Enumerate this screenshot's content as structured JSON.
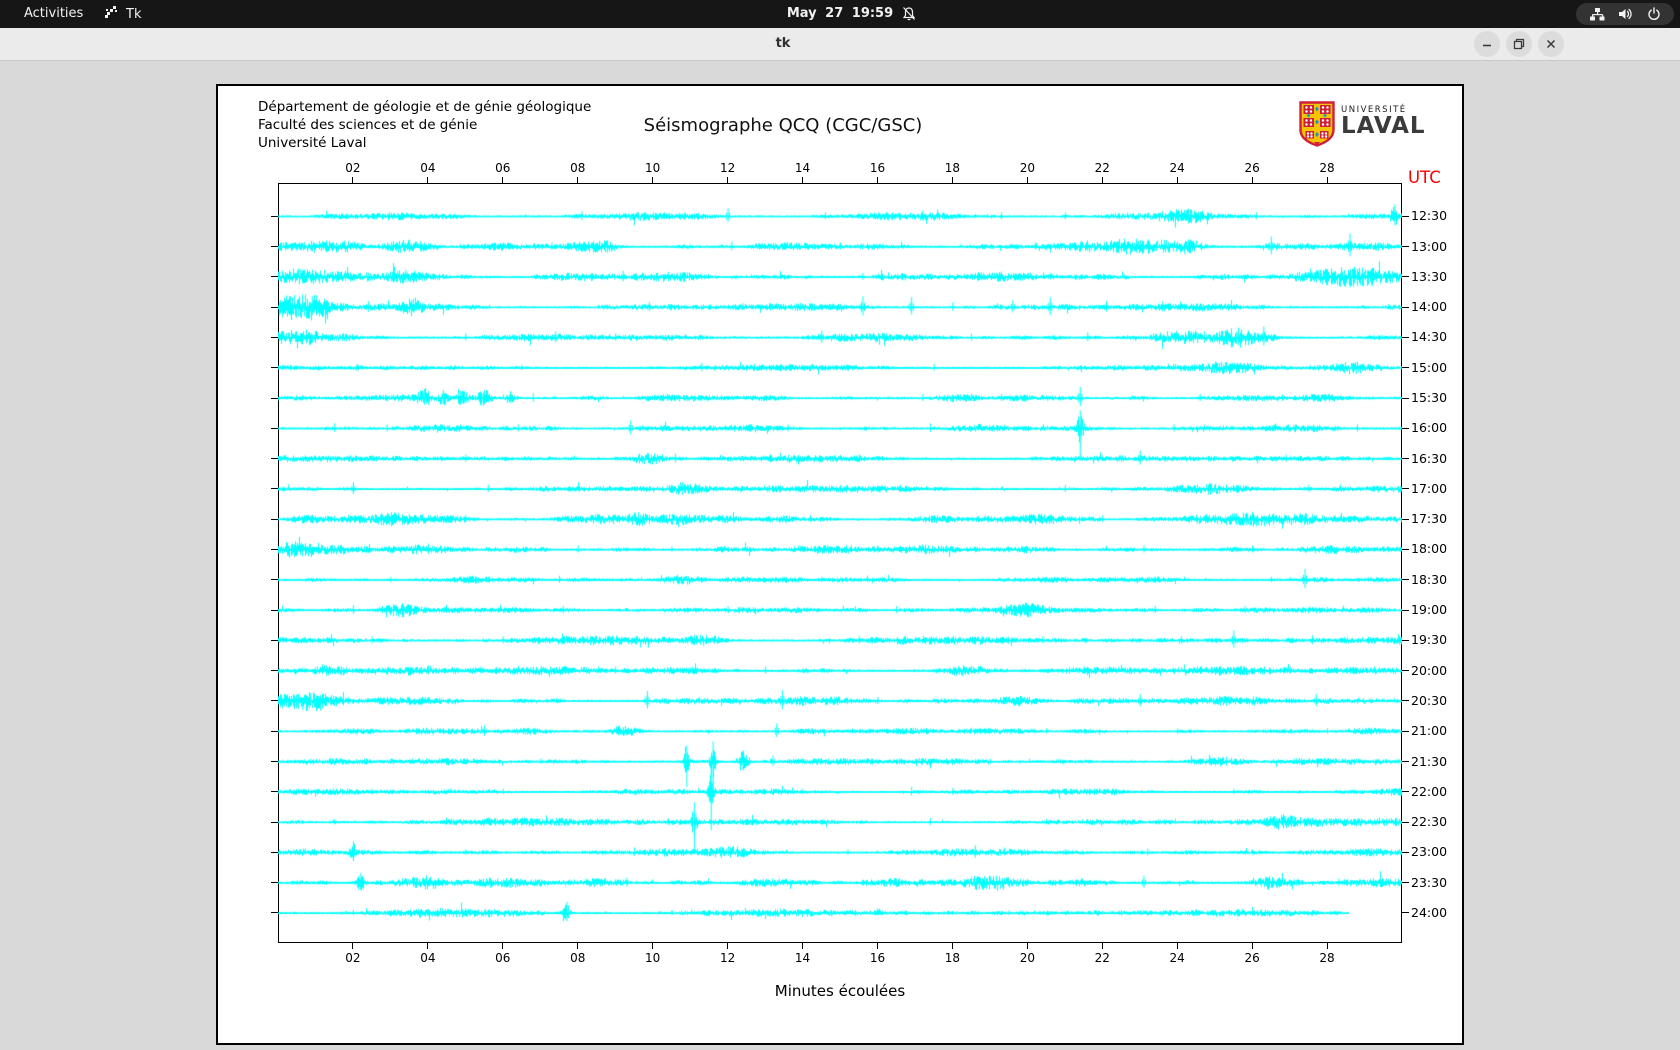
{
  "topbar": {
    "activities": "Activities",
    "app_name": "Tk",
    "clock": "May 27 19:59",
    "icons": [
      "tk-icon",
      "bell-muted-icon",
      "network-icon",
      "volume-icon",
      "power-icon"
    ]
  },
  "titlebar": {
    "title": "tk",
    "icons": [
      "minimize-icon",
      "restore-icon",
      "close-icon"
    ]
  },
  "logo": {
    "line1": "UNIVERSITÉ",
    "line2": "LAVAL"
  },
  "plot": {
    "header_lines": [
      "Département de géologie et de génie géologique",
      "Faculté des sciences et de génie",
      "Université Laval"
    ],
    "title": "Séismographe QCQ (CGC/GSC)",
    "utc_label": "UTC",
    "xlabel": "Minutes écoulées",
    "x_ticks": [
      "02",
      "04",
      "06",
      "08",
      "10",
      "12",
      "14",
      "16",
      "18",
      "20",
      "22",
      "24",
      "26",
      "28"
    ],
    "x_minutes": [
      2,
      4,
      6,
      8,
      10,
      12,
      14,
      16,
      18,
      20,
      22,
      24,
      26,
      28
    ],
    "trace_color": "#00ffff",
    "utc_color": "#ff0000",
    "axis_range_minutes": [
      0,
      30
    ],
    "rows": [
      {
        "label": "12:30",
        "base": 1.8,
        "events": [
          [
            8.1,
            5,
            0
          ],
          [
            10.3,
            4,
            0
          ],
          [
            12.0,
            8,
            0
          ],
          [
            14.6,
            4,
            0
          ],
          [
            17.2,
            6,
            0
          ],
          [
            19.3,
            4,
            0
          ],
          [
            21.0,
            4,
            0
          ],
          [
            24.2,
            5,
            0.5
          ],
          [
            26.1,
            4,
            0
          ],
          [
            29.8,
            12,
            0.08
          ]
        ]
      },
      {
        "label": "13:00",
        "base": 2.0,
        "events": [
          [
            1.6,
            6,
            0.5
          ],
          [
            3.5,
            7,
            0.4
          ],
          [
            7.3,
            4,
            0
          ],
          [
            8.6,
            5,
            0.3
          ],
          [
            12.1,
            5,
            0
          ],
          [
            15.0,
            4,
            0
          ],
          [
            20.2,
            4,
            0
          ],
          [
            22.9,
            8,
            0.7
          ],
          [
            24.3,
            6,
            0.3
          ],
          [
            26.5,
            10,
            0
          ],
          [
            28.6,
            13,
            0
          ]
        ]
      },
      {
        "label": "13:30",
        "base": 2.2,
        "events": [
          [
            0.6,
            6,
            0.7
          ],
          [
            3.4,
            7,
            0.5
          ],
          [
            9.2,
            6,
            0
          ],
          [
            10.4,
            5,
            0
          ],
          [
            15.6,
            4,
            0
          ],
          [
            20.6,
            4,
            0
          ],
          [
            28.8,
            8,
            0.8
          ]
        ]
      },
      {
        "label": "14:00",
        "base": 1.9,
        "events": [
          [
            0.3,
            9,
            0.3
          ],
          [
            0.9,
            11,
            0.4
          ],
          [
            2.4,
            6,
            0
          ],
          [
            3.6,
            7,
            0.2
          ],
          [
            9.9,
            5,
            0
          ],
          [
            12.4,
            4,
            0
          ],
          [
            15.6,
            11,
            0
          ],
          [
            16.9,
            10,
            0
          ],
          [
            18.0,
            5,
            0
          ],
          [
            19.6,
            7,
            0
          ],
          [
            20.6,
            10,
            0
          ],
          [
            22.1,
            6,
            0
          ],
          [
            23.6,
            6,
            0
          ],
          [
            25.0,
            4,
            0
          ]
        ]
      },
      {
        "label": "14:30",
        "base": 1.9,
        "events": [
          [
            0.5,
            6,
            0.4
          ],
          [
            5.0,
            4,
            0
          ],
          [
            7.4,
            6,
            0
          ],
          [
            9.0,
            4,
            0
          ],
          [
            14.5,
            7,
            0
          ],
          [
            18.5,
            4,
            0
          ],
          [
            21.6,
            5,
            0
          ],
          [
            24.0,
            4,
            0.5
          ],
          [
            25.7,
            8,
            0.5
          ],
          [
            26.3,
            11,
            0
          ]
        ]
      },
      {
        "label": "15:00",
        "base": 1.5,
        "events": [
          [
            2.1,
            4,
            0
          ],
          [
            6.5,
            3,
            0
          ],
          [
            11.3,
            5,
            0
          ],
          [
            12.7,
            4,
            0
          ],
          [
            17.5,
            4,
            0
          ],
          [
            25.3,
            5,
            0.6
          ],
          [
            28.7,
            5,
            0.4
          ]
        ]
      },
      {
        "label": "15:30",
        "base": 1.7,
        "events": [
          [
            3.9,
            9,
            0.12
          ],
          [
            4.4,
            8,
            0.1
          ],
          [
            4.9,
            7,
            0.1
          ],
          [
            5.5,
            8,
            0.12
          ],
          [
            6.2,
            7,
            0.1
          ],
          [
            6.8,
            5,
            0
          ],
          [
            17.2,
            4,
            0
          ],
          [
            19.3,
            4,
            0
          ],
          [
            21.4,
            11,
            0
          ],
          [
            24.6,
            4,
            0
          ],
          [
            26.8,
            4,
            0
          ]
        ]
      },
      {
        "label": "16:00",
        "base": 1.7,
        "events": [
          [
            1.5,
            5,
            0
          ],
          [
            2.9,
            4,
            0
          ],
          [
            6.4,
            4,
            0
          ],
          [
            9.4,
            8,
            0
          ],
          [
            13.6,
            4,
            0
          ],
          [
            17.4,
            5,
            0
          ],
          [
            21.4,
            18,
            0.06
          ],
          [
            23.9,
            4,
            0
          ],
          [
            26.6,
            4,
            0
          ],
          [
            28.8,
            4,
            0
          ]
        ]
      },
      {
        "label": "16:30",
        "base": 1.7,
        "events": [
          [
            5.0,
            4,
            0
          ],
          [
            9.9,
            6,
            0.35
          ],
          [
            10.6,
            5,
            0
          ],
          [
            15.5,
            4,
            0
          ],
          [
            23.0,
            8,
            0
          ],
          [
            26.9,
            4,
            0
          ]
        ]
      },
      {
        "label": "17:00",
        "base": 1.7,
        "events": [
          [
            2.0,
            7,
            0
          ],
          [
            5.6,
            4,
            0
          ],
          [
            10.9,
            6,
            0.3
          ],
          [
            13.1,
            4,
            0
          ],
          [
            16.6,
            4,
            0
          ],
          [
            21.0,
            4,
            0
          ],
          [
            24.9,
            5,
            0.7
          ],
          [
            27.5,
            4,
            0
          ]
        ]
      },
      {
        "label": "17:30",
        "base": 2.4,
        "events": [
          [
            2.9,
            5,
            0.3
          ],
          [
            5.0,
            4,
            0
          ],
          [
            8.6,
            5,
            0.4
          ],
          [
            9.6,
            6,
            0.2
          ],
          [
            11.1,
            4,
            0
          ],
          [
            14.2,
            4,
            0
          ],
          [
            19.6,
            4,
            0
          ],
          [
            22.0,
            4,
            0
          ],
          [
            25.6,
            6,
            0.9
          ],
          [
            28.2,
            4,
            0
          ]
        ]
      },
      {
        "label": "18:00",
        "base": 2.1,
        "events": [
          [
            0.4,
            6,
            0.5
          ],
          [
            1.5,
            4,
            0
          ],
          [
            4.0,
            6,
            0
          ],
          [
            8.0,
            4,
            0
          ],
          [
            10.5,
            3,
            0
          ],
          [
            16.0,
            4,
            0
          ],
          [
            19.5,
            3,
            0
          ],
          [
            23.1,
            4,
            0
          ],
          [
            26.0,
            4,
            0
          ]
        ]
      },
      {
        "label": "18:30",
        "base": 1.5,
        "events": [
          [
            3.0,
            3,
            0
          ],
          [
            7.5,
            4,
            0
          ],
          [
            10.8,
            5,
            0.4
          ],
          [
            14.5,
            3,
            0
          ],
          [
            21.0,
            3,
            0
          ],
          [
            26.5,
            3,
            0
          ],
          [
            27.4,
            11,
            0
          ]
        ]
      },
      {
        "label": "19:00",
        "base": 1.8,
        "events": [
          [
            2.0,
            5,
            0
          ],
          [
            3.3,
            6,
            0.35
          ],
          [
            7.6,
            4,
            0
          ],
          [
            12.0,
            4,
            0
          ],
          [
            16.5,
            4,
            0
          ],
          [
            19.9,
            5,
            0.5
          ],
          [
            23.4,
            4,
            0
          ],
          [
            25.8,
            4,
            0
          ],
          [
            28.0,
            3,
            0
          ]
        ]
      },
      {
        "label": "19:30",
        "base": 2.1,
        "events": [
          [
            2.5,
            4,
            0
          ],
          [
            6.0,
            4,
            0
          ],
          [
            11.4,
            5,
            0.35
          ],
          [
            15.5,
            4,
            0
          ],
          [
            20.4,
            4,
            0
          ],
          [
            24.1,
            4,
            0
          ],
          [
            25.5,
            10,
            0
          ],
          [
            27.6,
            5,
            0
          ]
        ]
      },
      {
        "label": "20:00",
        "base": 2.1,
        "events": [
          [
            1.4,
            5,
            0.35
          ],
          [
            5.4,
            4,
            0
          ],
          [
            9.0,
            4,
            0
          ],
          [
            13.0,
            4,
            0
          ],
          [
            18.4,
            4,
            0.35
          ],
          [
            21.5,
            4,
            0
          ],
          [
            24.9,
            4,
            0
          ],
          [
            27.0,
            4,
            0
          ]
        ]
      },
      {
        "label": "20:30",
        "base": 2.0,
        "events": [
          [
            0.5,
            7,
            0.45
          ],
          [
            1.2,
            6,
            0.3
          ],
          [
            4.0,
            4,
            0
          ],
          [
            9.85,
            10,
            0
          ],
          [
            13.45,
            11,
            0
          ],
          [
            16.0,
            4,
            0
          ],
          [
            19.7,
            5,
            0.45
          ],
          [
            23.0,
            7,
            0
          ],
          [
            27.7,
            7,
            0
          ]
        ]
      },
      {
        "label": "21:00",
        "base": 1.5,
        "events": [
          [
            2.0,
            3,
            0
          ],
          [
            5.5,
            6,
            0
          ],
          [
            9.2,
            6,
            0.22
          ],
          [
            13.3,
            8,
            0
          ],
          [
            16.5,
            3,
            0
          ],
          [
            20.5,
            3,
            0
          ],
          [
            24.0,
            3,
            0
          ],
          [
            28.0,
            3,
            0
          ]
        ]
      },
      {
        "label": "21:30",
        "base": 1.6,
        "events": [
          [
            3.0,
            3,
            0
          ],
          [
            7.0,
            3,
            0
          ],
          [
            10.9,
            16,
            0.05
          ],
          [
            11.6,
            20,
            0.05
          ],
          [
            12.4,
            11,
            0.1
          ],
          [
            13.2,
            6,
            0
          ],
          [
            15.0,
            3,
            0
          ],
          [
            19.0,
            3,
            0
          ],
          [
            25.2,
            4,
            0.4
          ],
          [
            28.0,
            3,
            0
          ]
        ]
      },
      {
        "label": "22:00",
        "base": 1.5,
        "events": [
          [
            2.5,
            3,
            0
          ],
          [
            6.0,
            3,
            0
          ],
          [
            11.55,
            24,
            0.05
          ],
          [
            14.0,
            3,
            0
          ],
          [
            16.9,
            5,
            0
          ],
          [
            18.0,
            4,
            0
          ],
          [
            21.0,
            3,
            0
          ],
          [
            25.5,
            3,
            0
          ]
        ]
      },
      {
        "label": "22:30",
        "base": 1.9,
        "events": [
          [
            1.5,
            3,
            0
          ],
          [
            6.3,
            4,
            0
          ],
          [
            10.4,
            4,
            0
          ],
          [
            11.1,
            20,
            0.05
          ],
          [
            14.0,
            3,
            0
          ],
          [
            17.4,
            4,
            0
          ],
          [
            20.5,
            3,
            0
          ],
          [
            23.5,
            3,
            0
          ],
          [
            26.8,
            5,
            0.35
          ]
        ]
      },
      {
        "label": "23:00",
        "base": 1.8,
        "events": [
          [
            2.0,
            11,
            0.08
          ],
          [
            5.0,
            3,
            0
          ],
          [
            9.5,
            5,
            0
          ],
          [
            12.2,
            4,
            0.35
          ],
          [
            15.2,
            3,
            0
          ],
          [
            18.6,
            7,
            0
          ],
          [
            21.0,
            3,
            0
          ],
          [
            23.2,
            4,
            0
          ],
          [
            26.0,
            3,
            0
          ]
        ]
      },
      {
        "label": "23:30",
        "base": 2.2,
        "events": [
          [
            2.2,
            10,
            0.08
          ],
          [
            4.0,
            5,
            0.3
          ],
          [
            6.5,
            3,
            0
          ],
          [
            9.3,
            5,
            0
          ],
          [
            13.0,
            4,
            0.5
          ],
          [
            16.0,
            3,
            0
          ],
          [
            19.0,
            4,
            0.4
          ],
          [
            23.1,
            7,
            0
          ],
          [
            26.4,
            5,
            0.35
          ],
          [
            28.3,
            4,
            0
          ]
        ]
      },
      {
        "label": "24:00",
        "base": 2.0,
        "end": 28.56,
        "events": [
          [
            2.0,
            3,
            0
          ],
          [
            4.0,
            3,
            0
          ],
          [
            7.7,
            11,
            0.06
          ],
          [
            10.5,
            3,
            0
          ],
          [
            13.5,
            3,
            0
          ],
          [
            16.0,
            3,
            0
          ],
          [
            19.5,
            3,
            0
          ],
          [
            22.5,
            3,
            0
          ],
          [
            25.0,
            3,
            0
          ]
        ]
      }
    ]
  }
}
